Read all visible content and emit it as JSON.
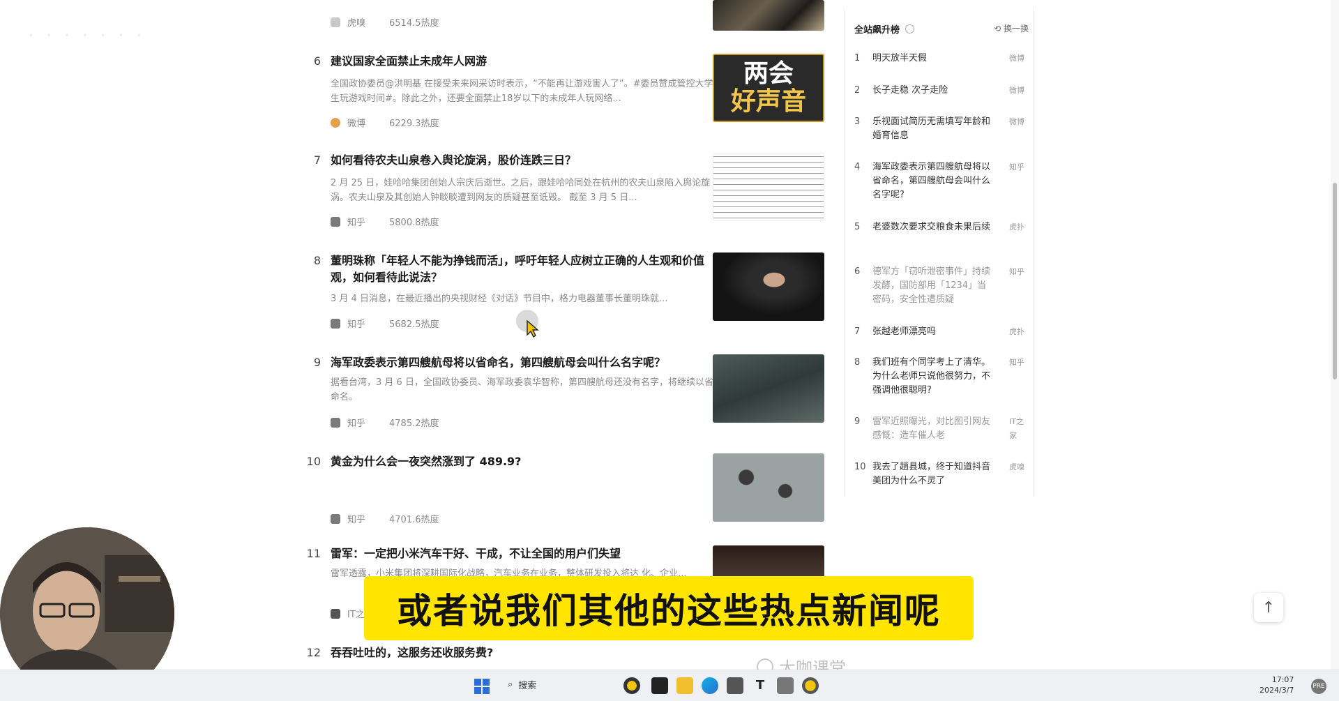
{
  "feed": {
    "item5": {
      "source": "虎嗅",
      "heat": "6514.5热度"
    },
    "items": [
      {
        "num": "6",
        "title": "建议国家全面禁止未成年人网游",
        "desc": "全国政协委员@洪明基 在接受未来网采访时表示，“不能再让游戏害人了”。#委员赞成管控大学生玩游戏时间#。除此之外，还要全面禁止18岁以下的未成年人玩网络...",
        "source": "微博",
        "heat": "6229.3热度",
        "thumb_text_1": "两会",
        "thumb_text_2": "好声音"
      },
      {
        "num": "7",
        "title": "如何看待农夫山泉卷入舆论旋涡，股价连跌三日？",
        "desc": "2 月 25 日，娃哈哈集团创始人宗庆后逝世。之后，跟娃哈哈同处在杭州的农夫山泉陷入舆论旋涡。农夫山泉及其创始人钟睒睒遭到网友的质疑甚至诋毁。 截至 3 月 5 日...",
        "source": "知乎",
        "heat": "5800.8热度"
      },
      {
        "num": "8",
        "title": "董明珠称「年轻人不能为挣钱而活」，呼吁年轻人应树立正确的人生观和价值观，如何看待此说法？",
        "desc": "3 月 4 日消息，在最近播出的央视财经《对话》节目中，格力电器董事长董明珠就...",
        "source": "知乎",
        "heat": "5682.5热度"
      },
      {
        "num": "9",
        "title": "海军政委表示第四艘航母将以省命名，第四艘航母会叫什么名字呢？",
        "desc": "据看台湾，3 月 6 日，全国政协委员、海军政委袁华智称，第四艘航母还没有名字，将继续以省命名。",
        "source": "知乎",
        "heat": "4785.2热度"
      },
      {
        "num": "10",
        "title": "黄金为什么会一夜突然涨到了 489.9?",
        "desc": "",
        "source": "知乎",
        "heat": "4701.6热度"
      },
      {
        "num": "11",
        "title": "雷军：一定把小米汽车干好、干成，不让全国的用户们失望",
        "desc": "雷军透露，小米集团将深耕国际化战略，汽车业务在业务，整体研发投入将达 化、企业...",
        "source": "IT之家",
        "heat": ""
      },
      {
        "num": "12",
        "title": "吞吞吐吐的，这服务还收服务费?",
        "desc": "",
        "source": "",
        "heat": ""
      }
    ]
  },
  "sidebar": {
    "title": "全站飙升榜",
    "switch_label": "换一换",
    "items": [
      {
        "num": "1",
        "title": "明天放半天假",
        "source": "微博"
      },
      {
        "num": "2",
        "title": "长子走稳 次子走险",
        "source": "微博"
      },
      {
        "num": "3",
        "title": "乐视面试简历无需填写年龄和婚育信息",
        "source": "微博"
      },
      {
        "num": "4",
        "title": "海军政委表示第四艘航母将以省命名，第四艘航母会叫什么名字呢?",
        "source": "知乎"
      },
      {
        "num": "5",
        "title": "老婆数次要求交粮食未果后续",
        "source": "虎扑"
      },
      {
        "num": "6",
        "title": "德军方「窃听泄密事件」持续发酵，国防部用「1234」当密码，安全性遭质疑",
        "source": "知乎"
      },
      {
        "num": "7",
        "title": "张越老师漂亮吗",
        "source": "虎扑"
      },
      {
        "num": "8",
        "title": "我们班有个同学考上了清华。为什么老师只说他很努力，不强调他很聪明?",
        "source": "知乎"
      },
      {
        "num": "9",
        "title": "雷军近照曝光，对比图引网友感慨：造车催人老",
        "source": "IT之家"
      },
      {
        "num": "10",
        "title": "我去了趟县城，终于知道抖音美团为什么不灵了",
        "source": "虎嗅"
      }
    ]
  },
  "subtitle": "或者说我们其他的这些热点新闻呢",
  "brand": "大咖课堂",
  "taskbar": {
    "search_label": "搜索",
    "time": "17:07",
    "date": "2024/3/7",
    "ime": "PRE"
  },
  "back_top": "↑"
}
